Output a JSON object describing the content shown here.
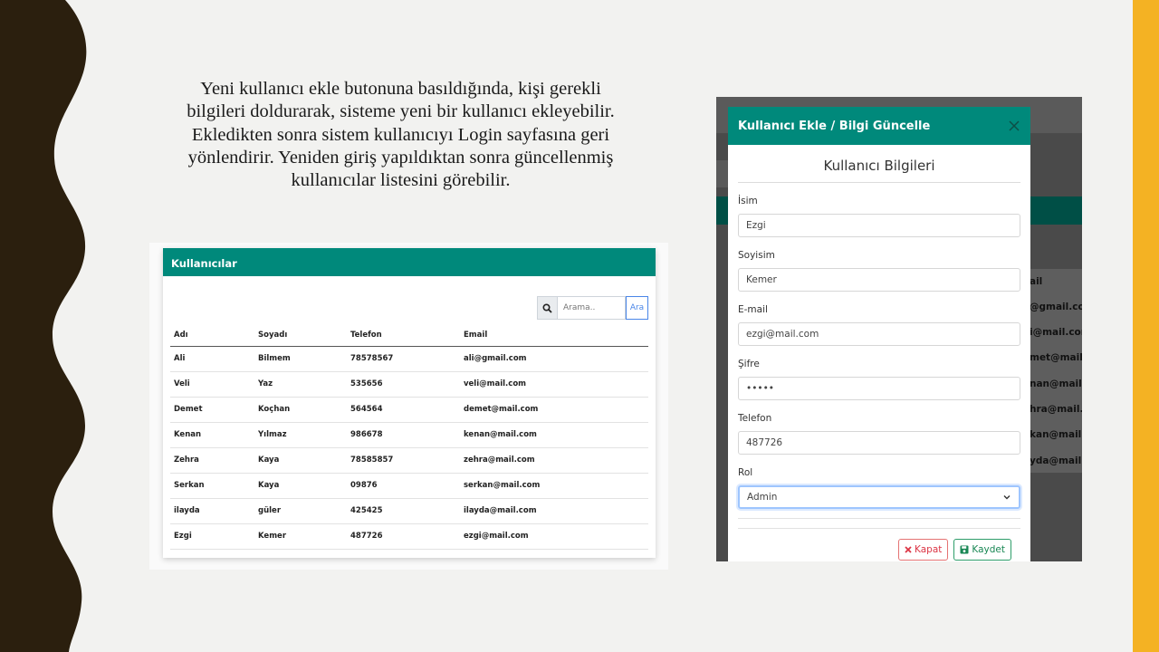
{
  "description": "Yeni kullanıcı ekle butonuna basıldığında, kişi gerekli bilgileri doldurarak, sisteme yeni bir kullanıcı ekleyebilir. Ekledikten sonra sistem kullanıcıyı Login sayfasına geri yönlendirir. Yeniden giriş yapıldıktan sonra güncellenmiş kullanıcılar listesini görebilir.",
  "colors": {
    "accent_gold": "#f4b223",
    "dark_brown": "#2b1f0e",
    "teal": "#00897b",
    "danger": "#dc3545",
    "success": "#198754"
  },
  "users_panel": {
    "title": "Kullanıcılar",
    "search": {
      "placeholder": "Arama..",
      "button_label": "Ara",
      "icon": "search-icon"
    },
    "columns": [
      "Adı",
      "Soyadı",
      "Telefon",
      "Email"
    ],
    "rows": [
      [
        "Ali",
        "Bilmem",
        "78578567",
        "ali@gmail.com"
      ],
      [
        "Veli",
        "Yaz",
        "535656",
        "veli@mail.com"
      ],
      [
        "Demet",
        "Koçhan",
        "564564",
        "demet@mail.com"
      ],
      [
        "Kenan",
        "Yılmaz",
        "986678",
        "kenan@mail.com"
      ],
      [
        "Zehra",
        "Kaya",
        "78585857",
        "zehra@mail.com"
      ],
      [
        "Serkan",
        "Kaya",
        "09876",
        "serkan@mail.com"
      ],
      [
        "ilayda",
        "güler",
        "425425",
        "ilayda@mail.com"
      ],
      [
        "Ezgi",
        "Kemer",
        "487726",
        "ezgi@mail.com"
      ]
    ]
  },
  "modal": {
    "title": "Kullanıcı Ekle / Bilgi Güncelle",
    "form_title": "Kullanıcı Bilgileri",
    "fields": [
      {
        "label": "İsim",
        "value": "Ezgi"
      },
      {
        "label": "Soyisim",
        "value": "Kemer"
      },
      {
        "label": "E-mail",
        "value": "ezgi@mail.com"
      },
      {
        "label": "Şifre",
        "value": "•••••"
      },
      {
        "label": "Telefon",
        "value": "487726"
      }
    ],
    "role": {
      "label": "Rol",
      "value": "Admin"
    },
    "cancel_label": "Kapat",
    "save_label": "Kaydet",
    "background_cells": [
      "ail",
      "@gmail.com",
      "i@mail.com",
      "met@mail.c",
      "nan@mail.c",
      "hra@mail.c",
      "kan@mail.c",
      "yda@mail.c"
    ]
  }
}
